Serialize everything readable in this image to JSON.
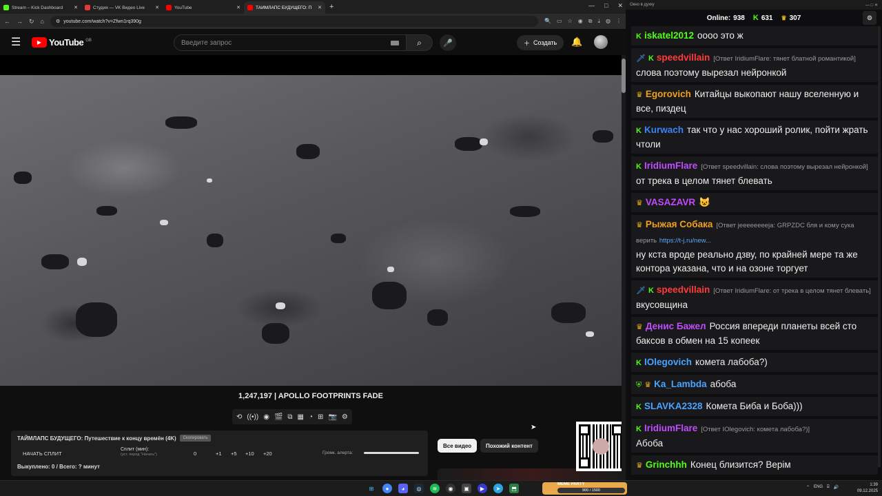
{
  "browser": {
    "tabs": [
      {
        "label": "Stream – Kick Dashboard",
        "color": "#53fc18",
        "active": false
      },
      {
        "label": "Студия — VK Видео Live",
        "color": "#e53935",
        "active": false
      },
      {
        "label": "YouTube",
        "color": "#ff0000",
        "active": false
      },
      {
        "label": "ТАЙМЛАПС БУДУЩЕГО: П",
        "color": "#ff0000",
        "active": true
      }
    ],
    "new_tab": "+",
    "url": "youtube.com/watch?v=Zfwn1rq390g"
  },
  "youtube": {
    "brand": "YouTube",
    "region": "GB",
    "search_placeholder": "Введите запрос",
    "create_label": "Создать",
    "video_caption": "1,247,197  |  APOLLO FOOTPRINTS FADE",
    "chip_all": "Все видео",
    "chip_similar": "Похожий контент"
  },
  "split_panel": {
    "title": "ТАЙМЛАПС БУДУЩЕГО: Путешествие к концу времён (4K)",
    "badge": "Скопировать",
    "start_label": "НАЧАТЬ СПЛИТ",
    "split_label": "Сплит (мин):",
    "split_hint": "(уст. перед \"Начать\")",
    "values": [
      "0",
      "+1",
      "+5",
      "+10",
      "+20"
    ],
    "alert_label": "Громк. алерта:",
    "alert_volume": 1.0,
    "done_text": "Выкуплено: 0 / Всего: ? минут"
  },
  "chat": {
    "window_title": "Окно в духку",
    "online_label": "Online:",
    "online_count": "938",
    "kick_count": "631",
    "crown_count": "307",
    "messages": [
      {
        "user": "iskatel2012",
        "color": "#53fc18",
        "badges": "K",
        "reply": "",
        "text": "оооо это ж"
      },
      {
        "user": "speedvillain",
        "color": "#ff3b3b",
        "badges": "SK",
        "reply": "[Ответ IridiumFlare: тянет блатной романтикой]",
        "text": "слова поэтому вырезал нейронкой"
      },
      {
        "user": "Egorovich",
        "color": "#f0a020",
        "badges": "C",
        "reply": "",
        "text": "Китайцы выкопают нашу вселенную и все, пиздец"
      },
      {
        "user": "Kurwach",
        "color": "#3b82f6",
        "badges": "K",
        "reply": "",
        "text": "так что у нас хороший ролик, пойти жрать чтоли"
      },
      {
        "user": "IridiumFlare",
        "color": "#c04cff",
        "badges": "K",
        "reply": "[Ответ speedvillain: слова поэтому вырезал нейронкой]",
        "text": "от трека в целом тянет блевать"
      },
      {
        "user": "VASAZAVR",
        "color": "#c04cff",
        "badges": "C",
        "reply": "",
        "text": "😺"
      },
      {
        "user": "Рыжая Собака",
        "color": "#f0a020",
        "badges": "C",
        "reply": "[Ответ jeeeeeeeeja: GRPZDC бля и кому сука верить",
        "link": "https://t-j.ru/new...",
        "text": "ну кста вроде реально дзву, по крайней мере та же контора указана, что и на озоне торгует"
      },
      {
        "user": "speedvillain",
        "color": "#ff3b3b",
        "badges": "SK",
        "reply": "[Ответ IridiumFlare: от трека в целом тянет блевать]",
        "text": "вкусовщина"
      },
      {
        "user": "Денис Бажел",
        "color": "#c04cff",
        "badges": "C",
        "reply": "",
        "text": "Россия впереди планеты всей сто баксов в обмен на 15 копеек"
      },
      {
        "user": "IOlegovich",
        "color": "#4aa3ff",
        "badges": "K",
        "reply": "",
        "text": "комета лабоба?)"
      },
      {
        "user": "Ka_Lambda",
        "color": "#4aa3ff",
        "badges": "GC",
        "reply": "",
        "text": "абоба"
      },
      {
        "user": "SLAVKA2328",
        "color": "#4aa3ff",
        "badges": "K",
        "reply": "",
        "text": "Комета Биба и Боба)))"
      },
      {
        "user": "IridiumFlare",
        "color": "#c04cff",
        "badges": "K",
        "reply": "[Ответ IOlegovich: комета лабоба?)]",
        "text": "Абоба"
      },
      {
        "user": "Grinchhh",
        "color": "#53fc18",
        "badges": "C",
        "reply": "",
        "text": "Конец близится? Верім"
      }
    ]
  },
  "taskbar": {
    "widget_title": "MEME PARTY",
    "widget_progress": "900 / 1500",
    "lang": "ENG",
    "time": "1:39",
    "date": "09.12.2025"
  }
}
